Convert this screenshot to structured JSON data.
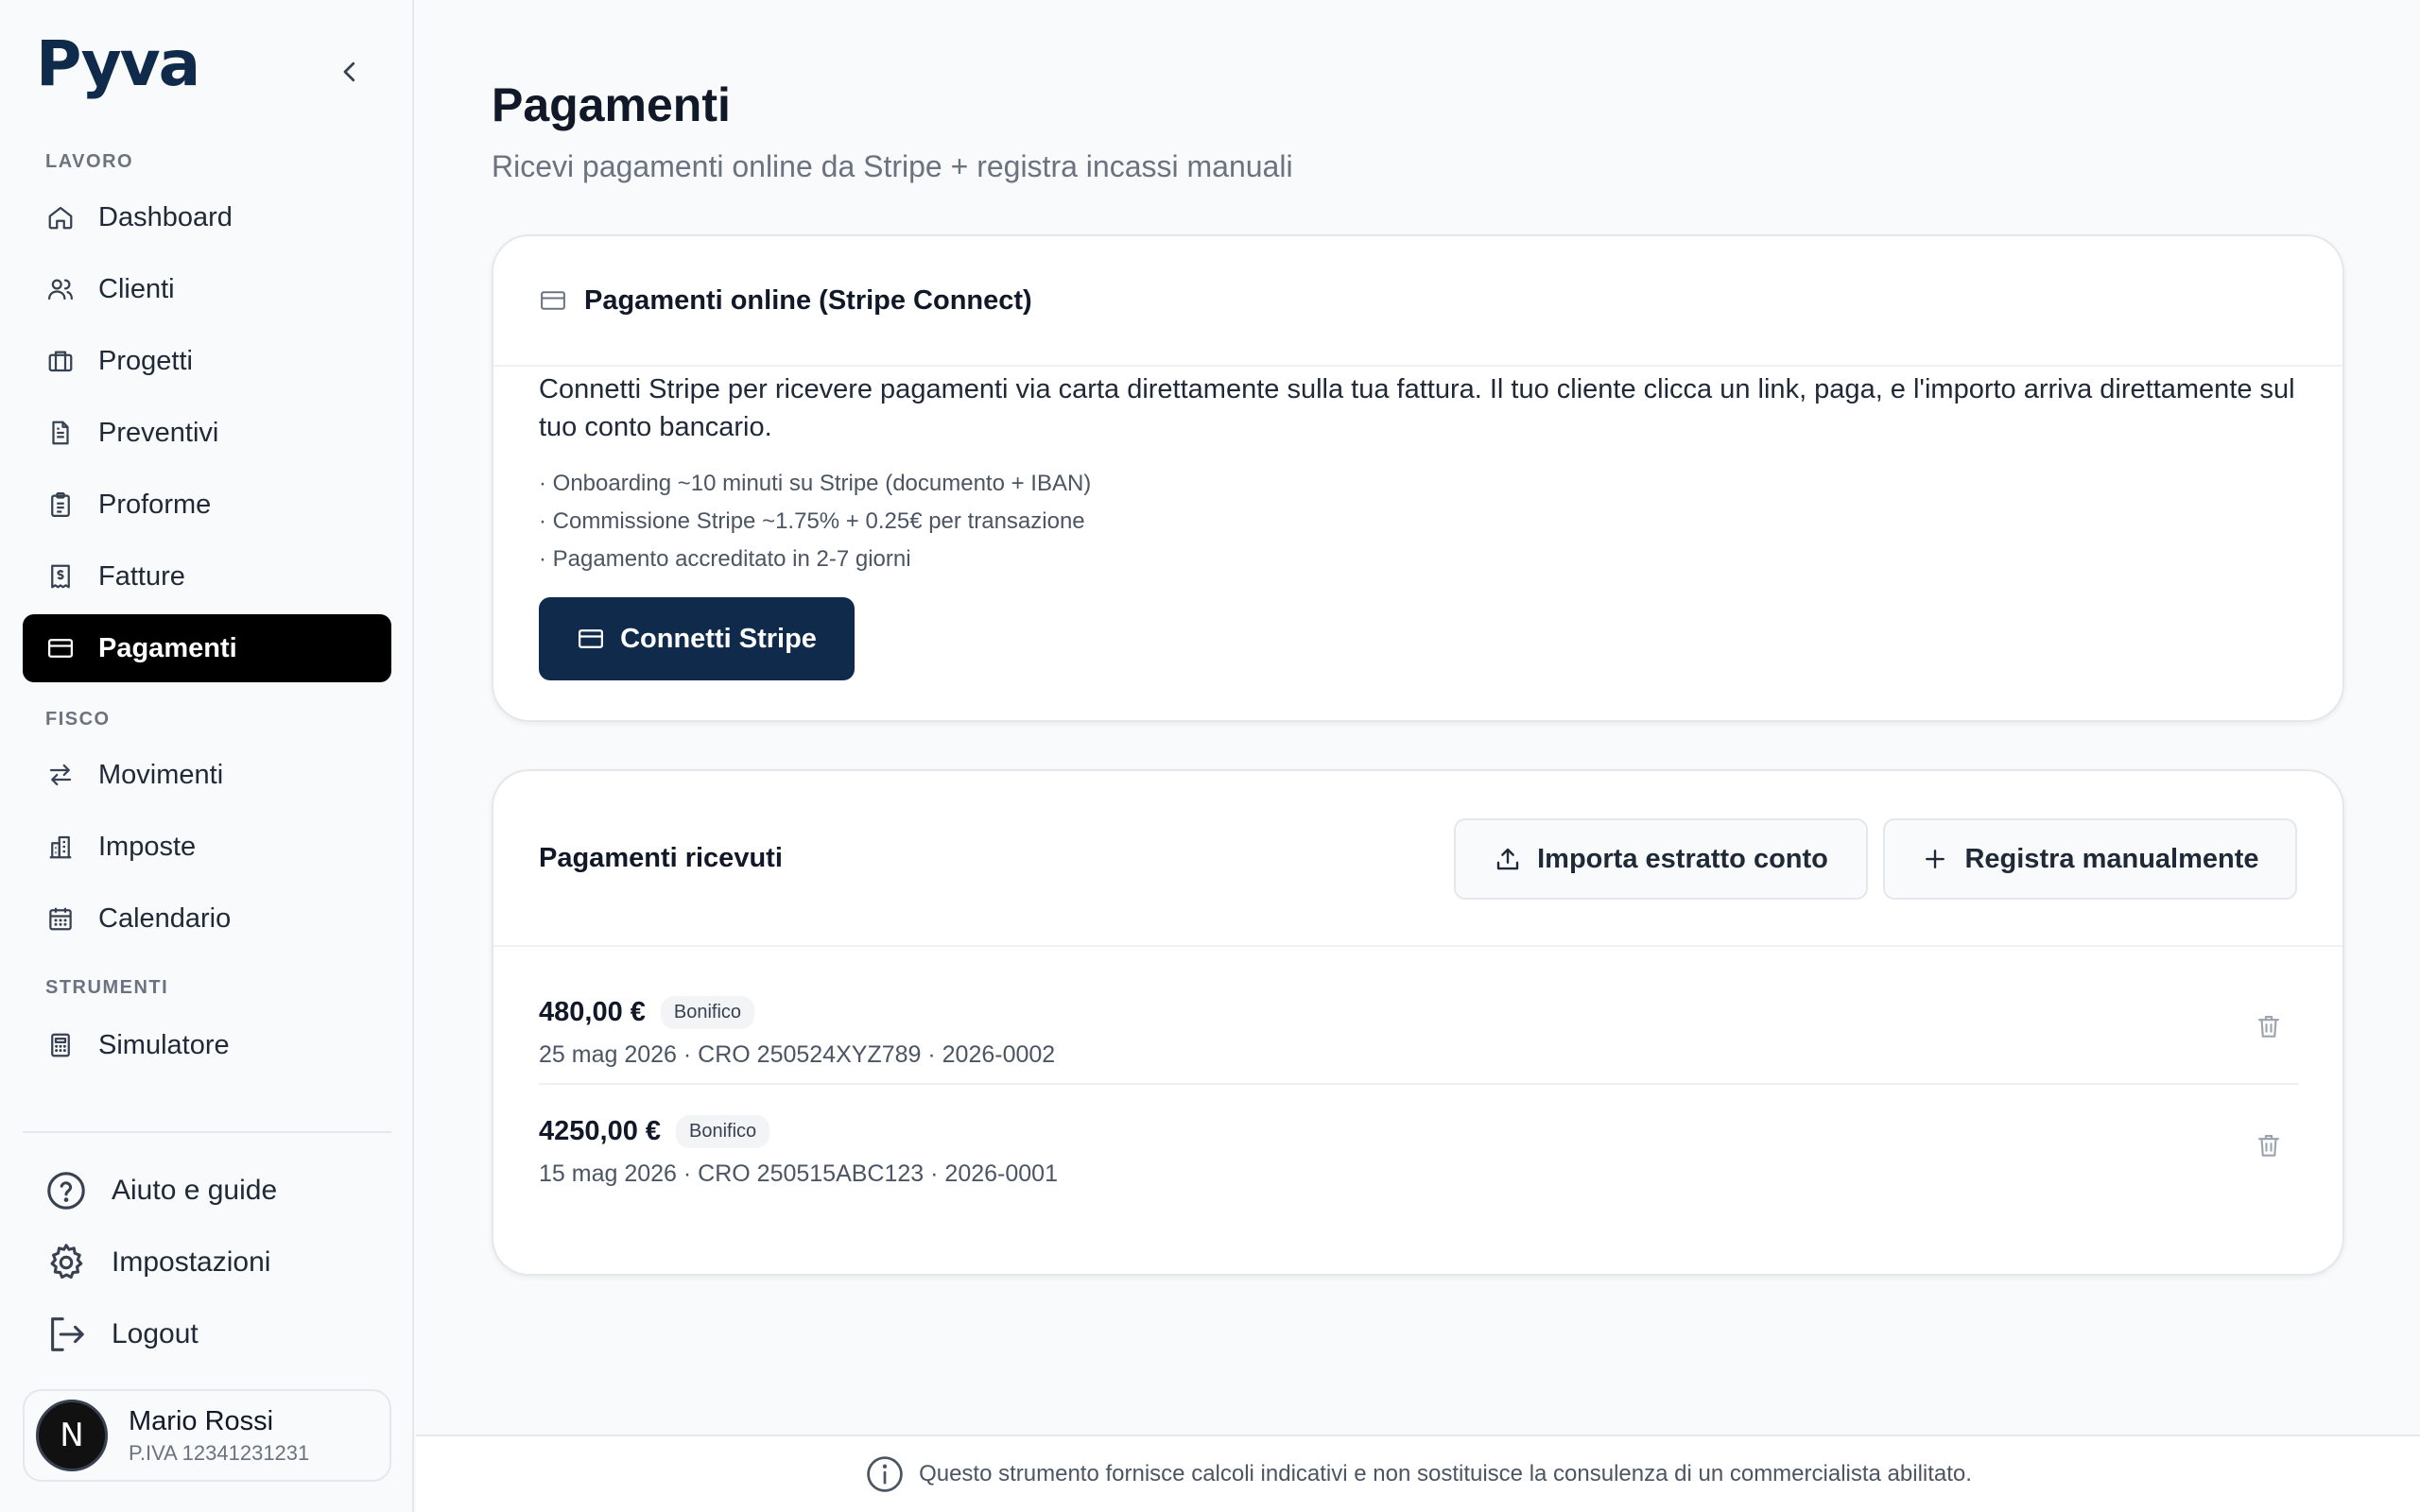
{
  "brand": {
    "logo_text": "Pyva"
  },
  "sidebar": {
    "sections": {
      "lavoro": "LAVORO",
      "fisco": "FISCO",
      "strumenti": "STRUMENTI"
    },
    "items": [
      {
        "label": "Dashboard",
        "icon": "home-icon"
      },
      {
        "label": "Clienti",
        "icon": "users-icon"
      },
      {
        "label": "Progetti",
        "icon": "briefcase-icon"
      },
      {
        "label": "Preventivi",
        "icon": "document-icon"
      },
      {
        "label": "Proforme",
        "icon": "clipboard-icon"
      },
      {
        "label": "Fatture",
        "icon": "invoice-icon"
      },
      {
        "label": "Pagamenti",
        "icon": "credit-card-icon",
        "active": true
      },
      {
        "label": "Movimenti",
        "icon": "arrows-icon"
      },
      {
        "label": "Imposte",
        "icon": "building-icon"
      },
      {
        "label": "Calendario",
        "icon": "calendar-icon"
      },
      {
        "label": "Simulatore",
        "icon": "calculator-icon"
      }
    ],
    "bottom": [
      {
        "label": "Aiuto e guide",
        "icon": "help-icon"
      },
      {
        "label": "Impostazioni",
        "icon": "gear-icon"
      },
      {
        "label": "Logout",
        "icon": "logout-icon"
      }
    ],
    "user": {
      "initial": "N",
      "name": "Mario Rossi",
      "vat": "P.IVA 12341231231"
    }
  },
  "page": {
    "title": "Pagamenti",
    "subtitle": "Ricevi pagamenti online da Stripe + registra incassi manuali"
  },
  "stripe_card": {
    "title": "Pagamenti online (Stripe Connect)",
    "description": "Connetti Stripe per ricevere pagamenti via carta direttamente sulla tua fattura. Il tuo cliente clicca un link, paga, e l'importo arriva direttamente sul tuo conto bancario.",
    "bullets": [
      "· Onboarding ~10 minuti su Stripe (documento + IBAN)",
      "· Commissione Stripe ~1.75% + 0.25€ per transazione",
      "· Pagamento accreditato in 2-7 giorni"
    ],
    "button_label": "Connetti Stripe"
  },
  "payments_card": {
    "title": "Pagamenti ricevuti",
    "import_label": "Importa estratto conto",
    "manual_label": "Registra manualmente",
    "rows": [
      {
        "amount": "480,00 €",
        "method": "Bonifico",
        "meta": "25 mag 2026 · CRO 250524XYZ789 · 2026-0002"
      },
      {
        "amount": "4250,00 €",
        "method": "Bonifico",
        "meta": "15 mag 2026 · CRO 250515ABC123 · 2026-0001"
      }
    ]
  },
  "footer": {
    "disclaimer": "Questo strumento fornisce calcoli indicativi e non sostituisce la consulenza di un commercialista abilitato."
  },
  "colors": {
    "brand_navy": "#0f2a4a",
    "active_nav": "#000000",
    "background": "#f9fafb"
  }
}
